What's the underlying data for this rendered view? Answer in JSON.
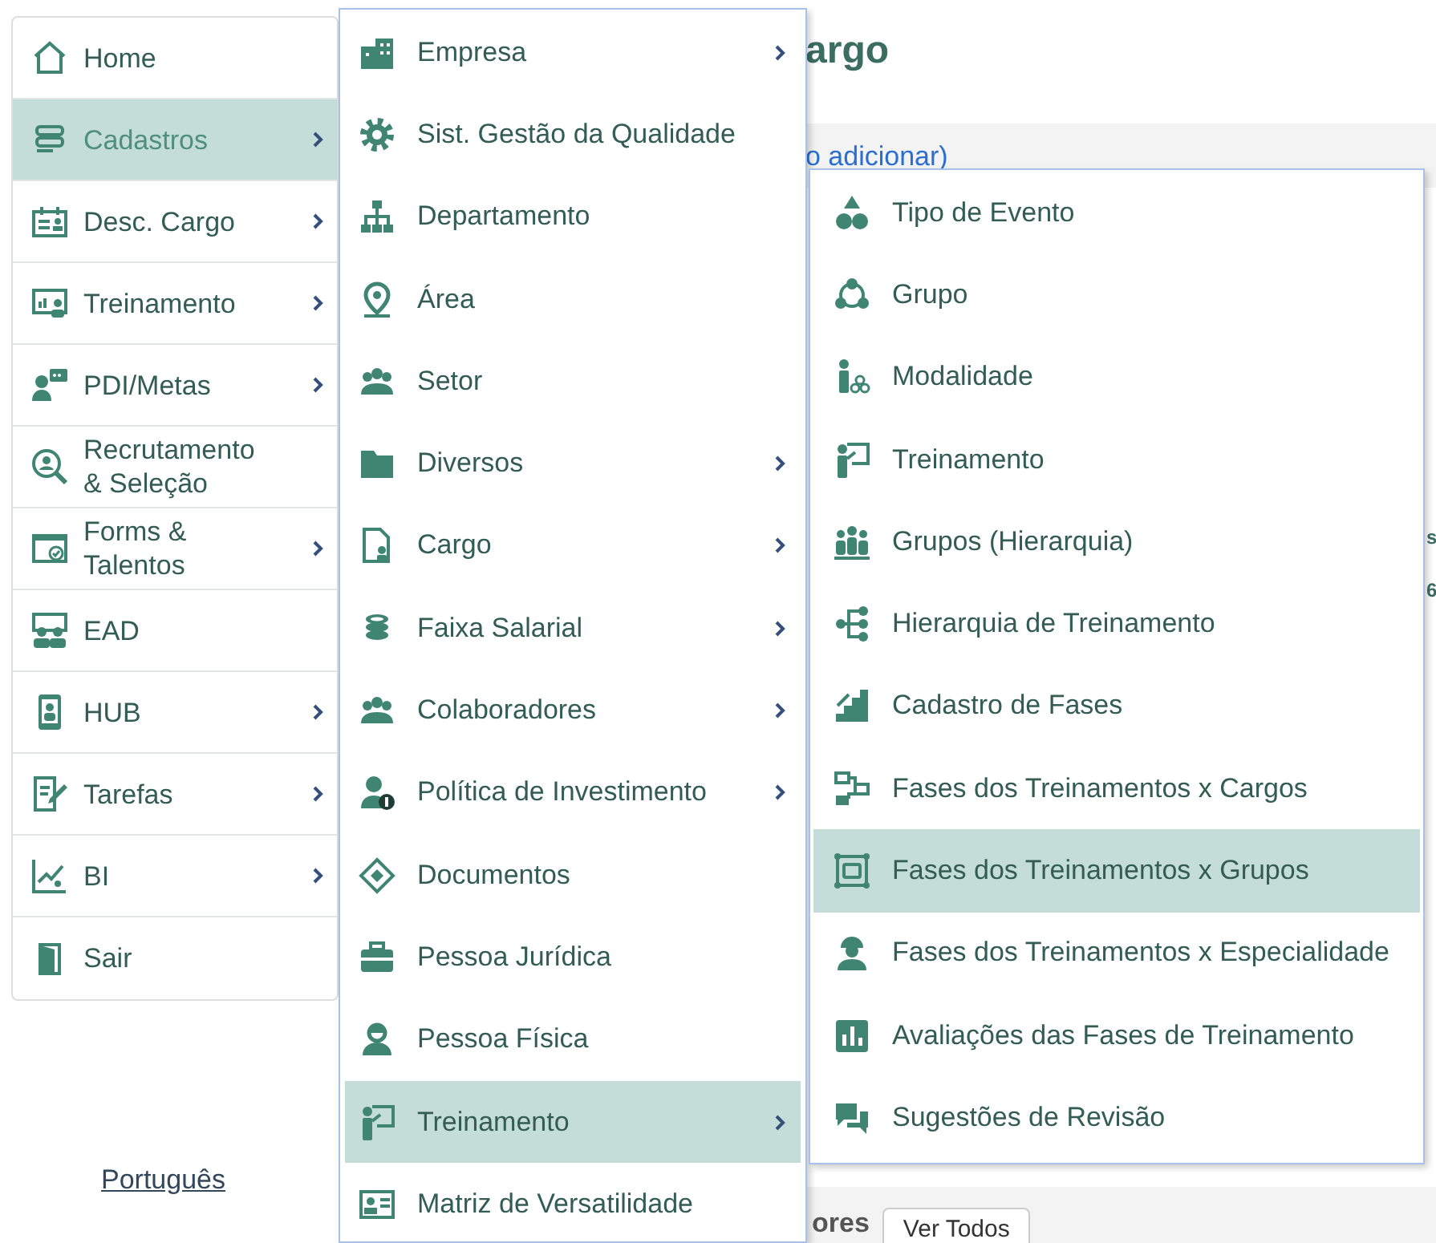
{
  "page": {
    "heading": "argo",
    "link": "o adicionar)",
    "edge_texts": [
      "s",
      "6"
    ],
    "section_label": "ores",
    "view_all_button": "Ver Todos"
  },
  "main_menu": [
    {
      "label": "Home",
      "selected": false,
      "has_submenu": false
    },
    {
      "label": "Cadastros",
      "selected": true,
      "has_submenu": true
    },
    {
      "label": "Desc. Cargo",
      "selected": false,
      "has_submenu": true
    },
    {
      "label": "Treinamento",
      "selected": false,
      "has_submenu": true
    },
    {
      "label": "PDI/Metas",
      "selected": false,
      "has_submenu": true
    },
    {
      "label": "Recrutamento & Seleção",
      "selected": false,
      "has_submenu": false
    },
    {
      "label": "Forms & Talentos",
      "selected": false,
      "has_submenu": true
    },
    {
      "label": "EAD",
      "selected": false,
      "has_submenu": false
    },
    {
      "label": "HUB",
      "selected": false,
      "has_submenu": true
    },
    {
      "label": "Tarefas",
      "selected": false,
      "has_submenu": true
    },
    {
      "label": "BI",
      "selected": false,
      "has_submenu": true
    },
    {
      "label": "Sair",
      "selected": false,
      "has_submenu": false
    }
  ],
  "language_link": "Português",
  "submenu": [
    {
      "label": "Empresa",
      "selected": false,
      "has_submenu": true
    },
    {
      "label": "Sist. Gestão da Qualidade",
      "selected": false,
      "has_submenu": false
    },
    {
      "label": "Departamento",
      "selected": false,
      "has_submenu": false
    },
    {
      "label": "Área",
      "selected": false,
      "has_submenu": false
    },
    {
      "label": "Setor",
      "selected": false,
      "has_submenu": false
    },
    {
      "label": "Diversos",
      "selected": false,
      "has_submenu": true
    },
    {
      "label": "Cargo",
      "selected": false,
      "has_submenu": true
    },
    {
      "label": "Faixa Salarial",
      "selected": false,
      "has_submenu": true
    },
    {
      "label": "Colaboradores",
      "selected": false,
      "has_submenu": true
    },
    {
      "label": "Política de Investimento",
      "selected": false,
      "has_submenu": true
    },
    {
      "label": "Documentos",
      "selected": false,
      "has_submenu": false
    },
    {
      "label": "Pessoa Jurídica",
      "selected": false,
      "has_submenu": false
    },
    {
      "label": "Pessoa Física",
      "selected": false,
      "has_submenu": false
    },
    {
      "label": "Treinamento",
      "selected": true,
      "has_submenu": true
    },
    {
      "label": "Matriz de Versatilidade",
      "selected": false,
      "has_submenu": false
    }
  ],
  "subsubmenu": [
    {
      "label": "Tipo de Evento",
      "selected": false
    },
    {
      "label": "Grupo",
      "selected": false
    },
    {
      "label": "Modalidade",
      "selected": false
    },
    {
      "label": "Treinamento",
      "selected": false
    },
    {
      "label": "Grupos (Hierarquia)",
      "selected": false
    },
    {
      "label": "Hierarquia de Treinamento",
      "selected": false
    },
    {
      "label": "Cadastro de Fases",
      "selected": false
    },
    {
      "label": "Fases dos Treinamentos x Cargos",
      "selected": false
    },
    {
      "label": "Fases dos Treinamentos x Grupos",
      "selected": true
    },
    {
      "label": "Fases dos Treinamentos x Especialidade",
      "selected": false
    },
    {
      "label": "Avaliações das Fases de Treinamento",
      "selected": false
    },
    {
      "label": "Sugestões de Revisão",
      "selected": false
    }
  ]
}
